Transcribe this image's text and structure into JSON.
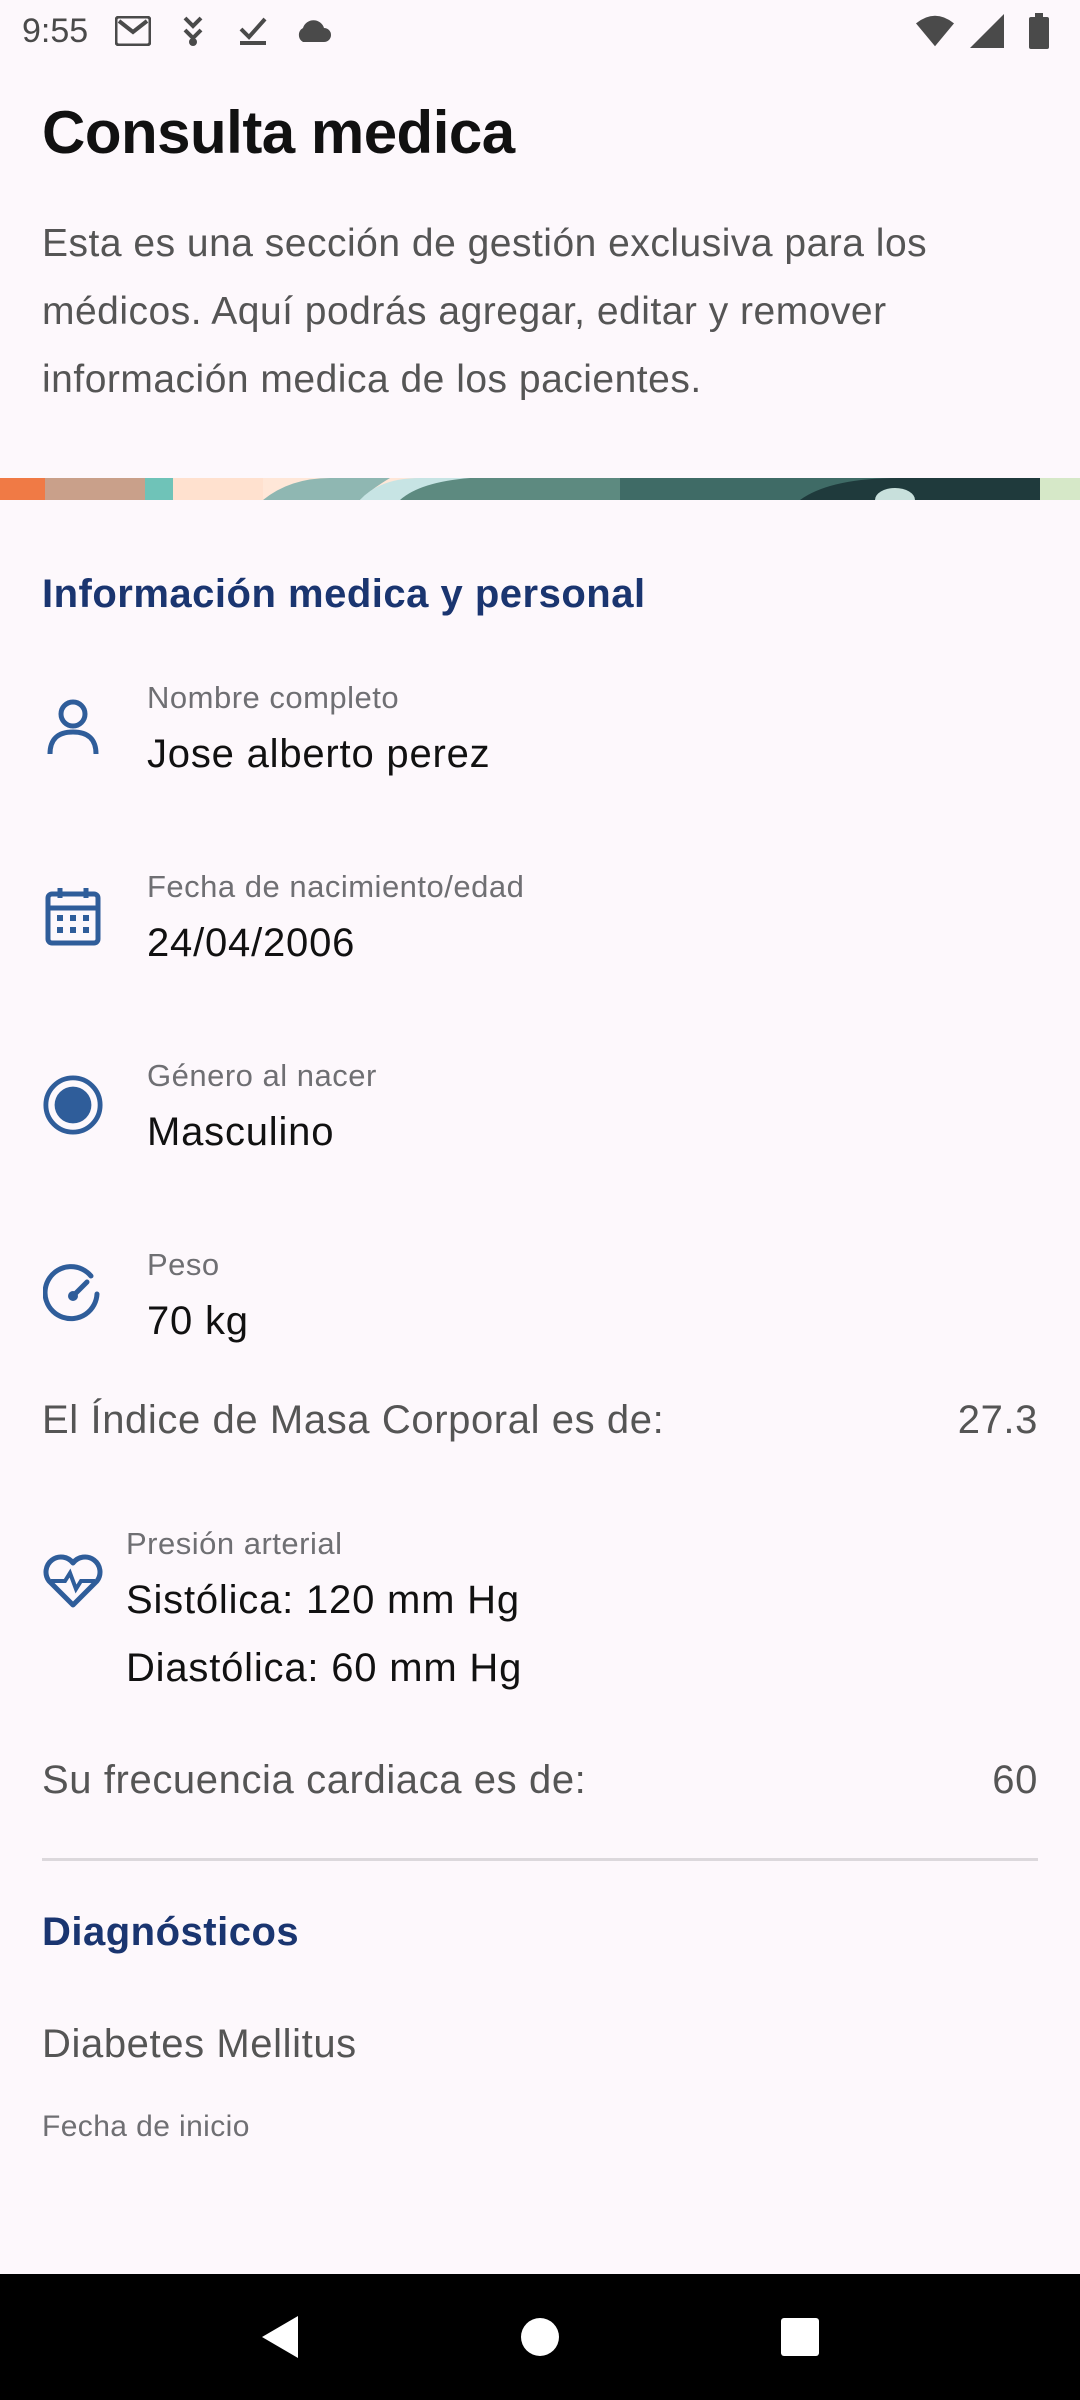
{
  "status_bar": {
    "time": "9:55",
    "left_icons": [
      "gmail-icon",
      "download-icon",
      "task-done-icon",
      "cloud-icon"
    ],
    "right_icons": [
      "wifi-icon",
      "cell-signal-icon",
      "battery-icon"
    ]
  },
  "header": {
    "title": "Consulta medica",
    "description": "Esta es una sección de gestión exclusiva para los médicos. Aquí podrás agregar, editar y remover información medica de los pacientes."
  },
  "personal_section": {
    "title": "Información medica y personal",
    "fields": {
      "name": {
        "label": "Nombre completo",
        "value": "Jose alberto perez",
        "icon": "person-icon"
      },
      "birth": {
        "label": "Fecha de nacimiento/edad",
        "value": "24/04/2006",
        "icon": "calendar-icon"
      },
      "gender": {
        "label": "Género al nacer",
        "value": "Masculino",
        "icon": "radio-selected-icon"
      },
      "weight": {
        "label": "Peso",
        "value": "70 kg",
        "icon": "gauge-icon"
      }
    },
    "bmi": {
      "label": "El Índice de Masa Corporal es de:",
      "value": "27.3"
    },
    "blood_pressure": {
      "label": "Presión arterial",
      "systolic": "Sistólica: 120 mm Hg",
      "diastolic": "Diastólica: 60 mm Hg",
      "icon": "heart-pulse-icon"
    },
    "heart_rate": {
      "label": "Su frecuencia cardiaca es de:",
      "value": "60"
    }
  },
  "diagnosis_section": {
    "title": "Diagnósticos",
    "items": [
      {
        "name": "Diabetes Mellitus",
        "date_label": "Fecha de inicio"
      }
    ]
  },
  "colors": {
    "accent": "#1a3570",
    "icon": "#2f5d9a",
    "background": "#fdf8fc"
  },
  "nav": {
    "icons": [
      "back-icon",
      "home-icon",
      "recents-icon"
    ]
  }
}
